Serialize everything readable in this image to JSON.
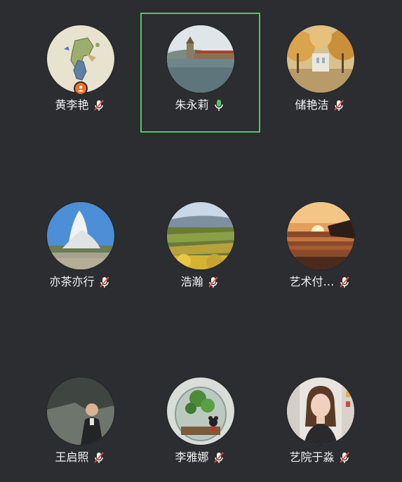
{
  "participants": [
    {
      "name": "黄李艳",
      "mic": "muted",
      "host": true,
      "active": false,
      "avatar": "map-art-icon"
    },
    {
      "name": "朱永莉",
      "mic": "active",
      "host": false,
      "active": true,
      "avatar": "bridge-lake-photo"
    },
    {
      "name": "储艳洁",
      "mic": "muted",
      "host": false,
      "active": false,
      "avatar": "autumn-trees-photo"
    },
    {
      "name": "亦茶亦行",
      "mic": "muted",
      "host": false,
      "active": false,
      "avatar": "geyser-photo"
    },
    {
      "name": "浩瀚",
      "mic": "muted",
      "host": false,
      "active": false,
      "avatar": "vineyard-photo"
    },
    {
      "name": "艺术付…",
      "mic": "muted",
      "host": false,
      "active": false,
      "avatar": "sunset-sea-photo"
    },
    {
      "name": "王启照",
      "mic": "muted",
      "host": false,
      "active": false,
      "avatar": "person-rock-photo"
    },
    {
      "name": "李雅娜",
      "mic": "muted",
      "host": false,
      "active": false,
      "avatar": "terrarium-photo"
    },
    {
      "name": "艺院于淼",
      "mic": "muted",
      "host": false,
      "active": false,
      "avatar": "woman-portrait-photo"
    }
  ],
  "colors": {
    "background": "#2b2d30",
    "active_border": "#56c46b",
    "mic_active": "#56c46b",
    "mic_muted_slash": "#e0514a",
    "host_badge": "#f0712b"
  }
}
